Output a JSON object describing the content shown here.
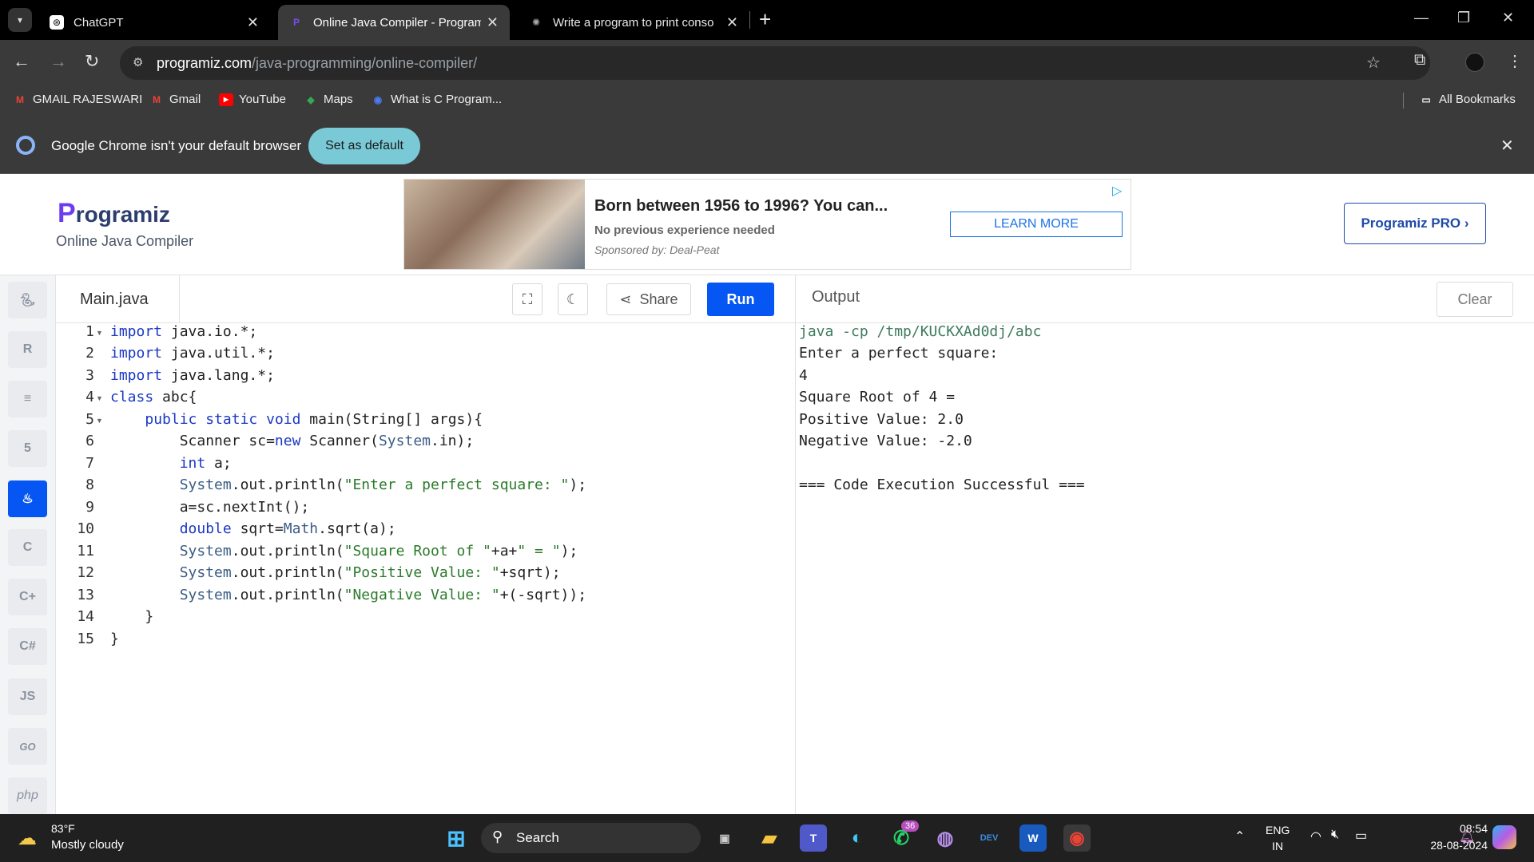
{
  "browser": {
    "tabs": [
      {
        "title": "ChatGPT",
        "active": false
      },
      {
        "title": "Online Java Compiler - Program",
        "active": true
      },
      {
        "title": "Write a program to print conso",
        "active": false
      }
    ],
    "new_tab": "+",
    "url_host": "programiz.com",
    "url_path": "/java-programming/online-compiler/",
    "bookmarks": [
      "GMAIL RAJESWARI",
      "Gmail",
      "YouTube",
      "Maps",
      "What is C Program..."
    ],
    "all_bookmarks": "All Bookmarks",
    "infobar_message": "Google Chrome isn't your default browser",
    "set_default": "Set as default"
  },
  "page": {
    "logo": "rogramiz",
    "logo_p": "P",
    "subtitle": "Online Java Compiler",
    "pro_button": "Programiz PRO ›",
    "ad": {
      "title": "Born between 1956 to 1996? You can...",
      "subtitle": "No previous experience needed",
      "sponsor": "Sponsored by: Deal-Peat",
      "cta": "LEARN MORE"
    },
    "sidebar_langs": [
      "py",
      "R",
      "sql",
      "html",
      "java",
      "C",
      "C++",
      "C#",
      "JS",
      "GO",
      "php"
    ],
    "editor": {
      "filename": "Main.java",
      "share": "Share",
      "run": "Run"
    },
    "output": {
      "title": "Output",
      "clear": "Clear",
      "lines": [
        "java -cp /tmp/KUCKXAd0dj/abc",
        "Enter a perfect square:",
        "4",
        "Square Root of 4 =",
        "Positive Value: 2.0",
        "Negative Value: -2.0",
        "",
        "=== Code Execution Successful ==="
      ]
    }
  },
  "code_lines": [
    "import java.io.*;",
    "import java.util.*;",
    "import java.lang.*;",
    "class abc{",
    "    public static void main(String[] args){",
    "        Scanner sc=new Scanner(System.in);",
    "        int a;",
    "        System.out.println(\"Enter a perfect square: \");",
    "        a=sc.nextInt();",
    "        double sqrt=Math.sqrt(a);",
    "        System.out.println(\"Square Root of \"+a+\" = \");",
    "        System.out.println(\"Positive Value: \"+sqrt);",
    "        System.out.println(\"Negative Value: \"+(-sqrt));",
    "    }",
    "}"
  ],
  "taskbar": {
    "temp": "83°F",
    "weather": "Mostly cloudy",
    "search": "Search",
    "whatsapp_badge": "36",
    "lang_top": "ENG",
    "lang_bottom": "IN",
    "time": "08:54",
    "date": "28-08-2024"
  },
  "colors": {
    "accent": "#0556f3",
    "keyword": "#1a38c4",
    "string": "#2a7a2a"
  }
}
